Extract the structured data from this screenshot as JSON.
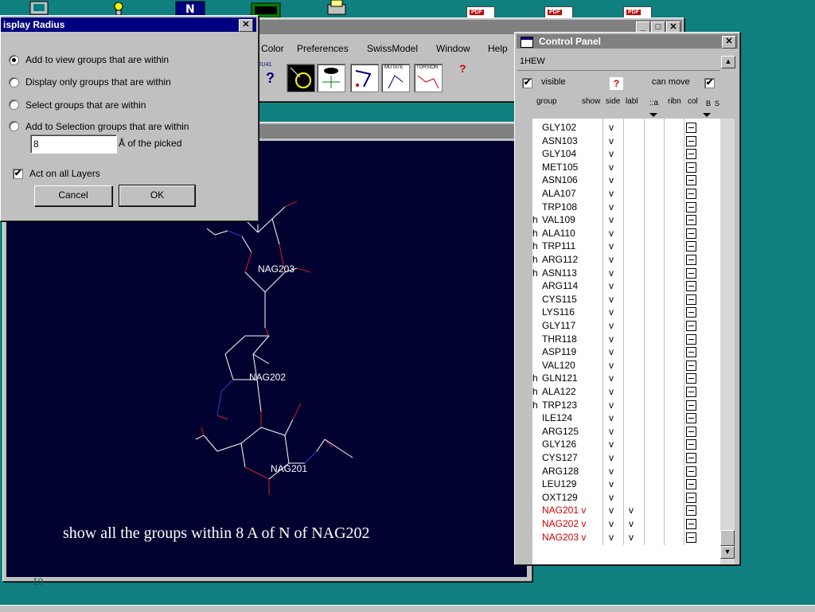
{
  "desktop": {
    "bottom_numeral": "10"
  },
  "main_window": {
    "menu": [
      "Color",
      "Preferences",
      "SwissModel",
      "Window",
      "Help"
    ],
    "tools": [
      {
        "name": "question-tool",
        "text": "?"
      },
      {
        "name": "eye-tool",
        "text": ""
      },
      {
        "name": "mutate-tool",
        "text": "MUTATE"
      },
      {
        "name": "torsion-tool",
        "text": "TORSION"
      },
      {
        "name": "help-tool",
        "text": "?"
      }
    ],
    "tool_badge": "EU41"
  },
  "display_radius": {
    "title": "isplay Radius",
    "close": "✕",
    "options": [
      {
        "label": "Add to view groups that are within",
        "selected": true
      },
      {
        "label": "Display only groups that are within",
        "selected": false
      },
      {
        "label": "Select groups that are within",
        "selected": false
      },
      {
        "label": "Add to Selection groups that are within",
        "selected": false
      }
    ],
    "radius_value": "8",
    "radius_unit": "Å of the picked",
    "act_on_all_layers": {
      "label": "Act on all Layers",
      "checked": true,
      "mark": "✔"
    },
    "cancel": "Cancel",
    "ok": "OK"
  },
  "viewer": {
    "close": "✕",
    "labels": [
      "NAG203",
      "NAG202",
      "NAG201"
    ],
    "caption": "show all the groups within 8 A of N of NAG202",
    "bg_color": "#020230"
  },
  "control_panel": {
    "title": "Control Panel",
    "close": "✕",
    "structure": "1HEW",
    "visible_label": "visible",
    "visible_mark": "✔",
    "help_mark": "?",
    "can_move_label": "can move",
    "can_move_mark": "✔",
    "columns": [
      "group",
      "show",
      "side",
      "labl",
      "::a",
      "ribn",
      "col",
      "B",
      "S"
    ],
    "scroll_up": "▲",
    "scroll_down": "▼",
    "rows": [
      {
        "h": "",
        "name": "GLY102",
        "show": "v",
        "side": "",
        "red": false
      },
      {
        "h": "",
        "name": "ASN103",
        "show": "v",
        "side": "",
        "red": false
      },
      {
        "h": "",
        "name": "GLY104",
        "show": "v",
        "side": "",
        "red": false
      },
      {
        "h": "",
        "name": "MET105",
        "show": "v",
        "side": "",
        "red": false
      },
      {
        "h": "",
        "name": "ASN106",
        "show": "v",
        "side": "",
        "red": false
      },
      {
        "h": "",
        "name": "ALA107",
        "show": "v",
        "side": "",
        "red": false
      },
      {
        "h": "",
        "name": "TRP108",
        "show": "v",
        "side": "",
        "red": false
      },
      {
        "h": "h",
        "name": "VAL109",
        "show": "v",
        "side": "",
        "red": false
      },
      {
        "h": "h",
        "name": "ALA110",
        "show": "v",
        "side": "",
        "red": false
      },
      {
        "h": "h",
        "name": "TRP111",
        "show": "v",
        "side": "",
        "red": false
      },
      {
        "h": "h",
        "name": "ARG112",
        "show": "v",
        "side": "",
        "red": false
      },
      {
        "h": "h",
        "name": "ASN113",
        "show": "v",
        "side": "",
        "red": false
      },
      {
        "h": "",
        "name": "ARG114",
        "show": "v",
        "side": "",
        "red": false
      },
      {
        "h": "",
        "name": "CYS115",
        "show": "v",
        "side": "",
        "red": false
      },
      {
        "h": "",
        "name": "LYS116",
        "show": "v",
        "side": "",
        "red": false
      },
      {
        "h": "",
        "name": "GLY117",
        "show": "v",
        "side": "",
        "red": false
      },
      {
        "h": "",
        "name": "THR118",
        "show": "v",
        "side": "",
        "red": false
      },
      {
        "h": "",
        "name": "ASP119",
        "show": "v",
        "side": "",
        "red": false
      },
      {
        "h": "",
        "name": "VAL120",
        "show": "v",
        "side": "",
        "red": false
      },
      {
        "h": "h",
        "name": "GLN121",
        "show": "v",
        "side": "",
        "red": false
      },
      {
        "h": "h",
        "name": "ALA122",
        "show": "v",
        "side": "",
        "red": false
      },
      {
        "h": "h",
        "name": "TRP123",
        "show": "v",
        "side": "",
        "red": false
      },
      {
        "h": "",
        "name": "ILE124",
        "show": "v",
        "side": "",
        "red": false
      },
      {
        "h": "",
        "name": "ARG125",
        "show": "v",
        "side": "",
        "red": false
      },
      {
        "h": "",
        "name": "GLY126",
        "show": "v",
        "side": "",
        "red": false
      },
      {
        "h": "",
        "name": "CYS127",
        "show": "v",
        "side": "",
        "red": false
      },
      {
        "h": "",
        "name": "ARG128",
        "show": "v",
        "side": "",
        "red": false
      },
      {
        "h": "",
        "name": "LEU129",
        "show": "v",
        "side": "",
        "red": false
      },
      {
        "h": "",
        "name": "OXT129",
        "show": "v",
        "side": "",
        "red": false
      },
      {
        "h": "",
        "name": "NAG201 v",
        "show": "v",
        "side": "v",
        "red": true
      },
      {
        "h": "",
        "name": "NAG202 v",
        "show": "v",
        "side": "v",
        "red": true
      },
      {
        "h": "",
        "name": "NAG203 v",
        "show": "v",
        "side": "v",
        "red": true
      }
    ]
  },
  "colors": {
    "desktop": "#0f7f7f",
    "title_active": "#000080",
    "title_inactive": "#808080",
    "highlight_red": "#d00000"
  }
}
